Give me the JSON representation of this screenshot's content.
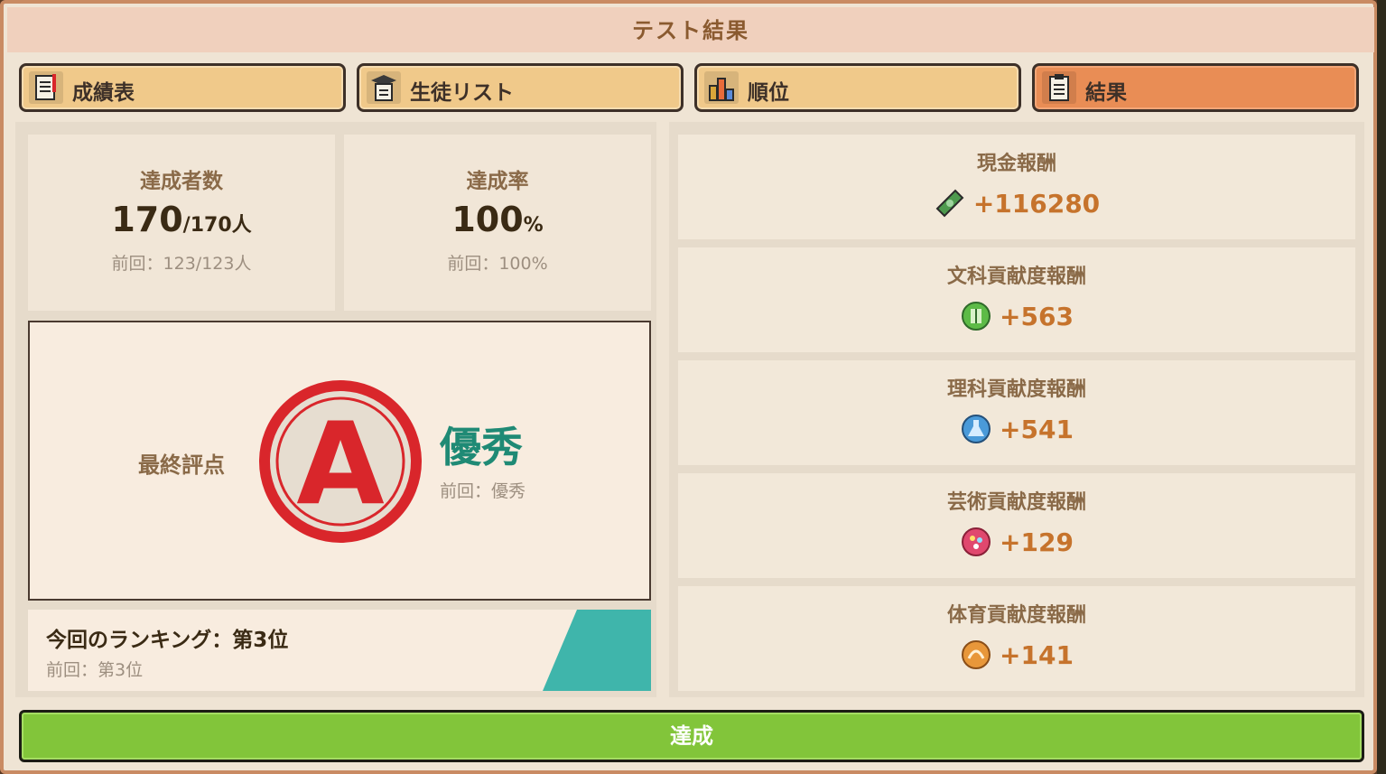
{
  "title": "テスト結果",
  "tabs": [
    {
      "label": "成績表",
      "icon": "report-card-icon",
      "active": false
    },
    {
      "label": "生徒リスト",
      "icon": "student-list-icon",
      "active": false
    },
    {
      "label": "順位",
      "icon": "ranking-icon",
      "active": false
    },
    {
      "label": "結果",
      "icon": "clipboard-icon",
      "active": true
    }
  ],
  "stats": {
    "achievers": {
      "title": "達成者数",
      "value": "170",
      "unit": "/170人",
      "prev": "前回：123/123人"
    },
    "rate": {
      "title": "達成率",
      "value": "100",
      "unit": "%",
      "prev": "前回：100%"
    }
  },
  "grade": {
    "label": "最終評点",
    "letter": "A",
    "text": "優秀",
    "prev": "前回：優秀",
    "badge_color": "#d9262b",
    "text_color": "#1f8a75"
  },
  "ranking": {
    "main": "今回のランキング：第3位",
    "prev": "前回：第3位",
    "accent_color": "#3fb5ab"
  },
  "rewards": [
    {
      "title": "現金報酬",
      "value": "+116280",
      "icon": "cash-icon"
    },
    {
      "title": "文科貢献度報酬",
      "value": "+563",
      "icon": "humanities-icon"
    },
    {
      "title": "理科貢献度報酬",
      "value": "+541",
      "icon": "science-icon"
    },
    {
      "title": "芸術貢献度報酬",
      "value": "+129",
      "icon": "art-icon"
    },
    {
      "title": "体育貢献度報酬",
      "value": "+141",
      "icon": "sports-icon"
    }
  ],
  "achieve_button": "達成"
}
